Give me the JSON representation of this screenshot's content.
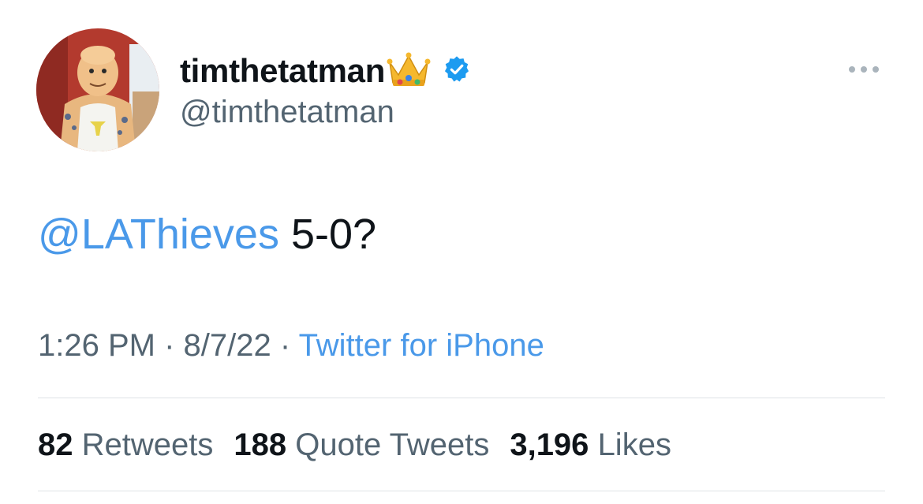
{
  "author": {
    "display_name": "timthetatman",
    "handle": "@timthetatman",
    "badge_emoji": "crown-icon",
    "verified": true
  },
  "tweet": {
    "mention": "@LAThieves",
    "text": " 5-0?"
  },
  "meta": {
    "time": "1:26 PM",
    "separator": " · ",
    "date": "8/7/22",
    "source": "Twitter for iPhone"
  },
  "stats": [
    {
      "count": "82",
      "label": "Retweets"
    },
    {
      "count": "188",
      "label": "Quote Tweets"
    },
    {
      "count": "3,196",
      "label": "Likes"
    }
  ],
  "colors": {
    "link": "#4a99e9",
    "text": "#0f1419",
    "secondary": "#536471",
    "divider": "#dfe3e6",
    "verified": "#1d9bf0"
  }
}
